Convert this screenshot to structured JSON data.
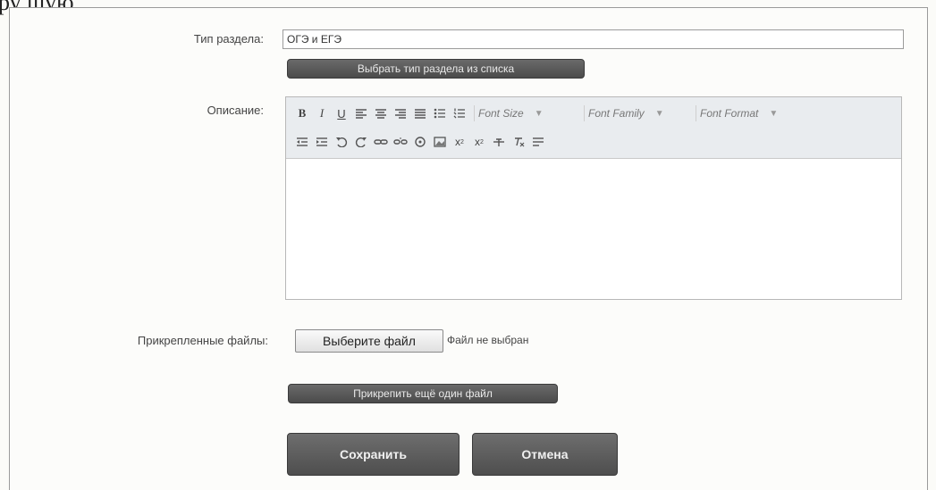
{
  "page_top_text": "ру шую..",
  "form": {
    "section_type": {
      "label": "Тип раздела:",
      "value": "ОГЭ и ЕГЭ",
      "choose_button": "Выбрать тип раздела из списка"
    },
    "description": {
      "label": "Описание:",
      "toolbar": {
        "bold": "B",
        "italic": "I",
        "underline": "U",
        "font_size": "Font Size",
        "font_family": "Font Family",
        "font_format": "Font Format",
        "subscript": "x",
        "superscript": "x"
      }
    },
    "attachments": {
      "label": "Прикрепленные файлы:",
      "file_button": "Выберите файл",
      "file_status": "Файл не выбран",
      "add_more_button": "Прикрепить ещё один файл"
    },
    "save_button": "Сохранить",
    "cancel_button": "Отмена"
  }
}
